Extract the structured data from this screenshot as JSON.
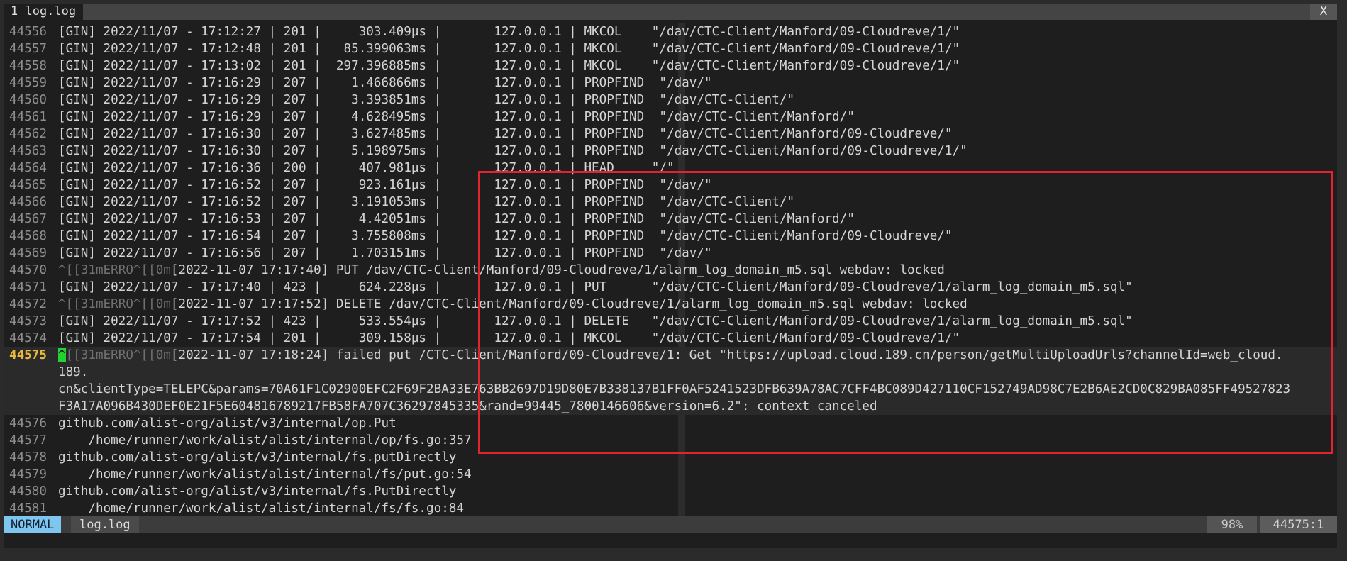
{
  "tabline": {
    "tab_label": "1 log.log",
    "close_label": "X"
  },
  "log": {
    "lines": [
      {
        "n": "44556",
        "text": "[GIN] 2022/11/07 - 17:12:27 | 201 |     303.409µs |       127.0.0.1 | MKCOL    \"/dav/CTC-Client/Manford/09-Cloudreve/1/\""
      },
      {
        "n": "44557",
        "text": "[GIN] 2022/11/07 - 17:12:48 | 201 |   85.399063ms |       127.0.0.1 | MKCOL    \"/dav/CTC-Client/Manford/09-Cloudreve/1/\""
      },
      {
        "n": "44558",
        "text": "[GIN] 2022/11/07 - 17:13:02 | 201 |  297.396885ms |       127.0.0.1 | MKCOL    \"/dav/CTC-Client/Manford/09-Cloudreve/1/\""
      },
      {
        "n": "44559",
        "text": "[GIN] 2022/11/07 - 17:16:29 | 207 |    1.466866ms |       127.0.0.1 | PROPFIND  \"/dav/\""
      },
      {
        "n": "44560",
        "text": "[GIN] 2022/11/07 - 17:16:29 | 207 |    3.393851ms |       127.0.0.1 | PROPFIND  \"/dav/CTC-Client/\""
      },
      {
        "n": "44561",
        "text": "[GIN] 2022/11/07 - 17:16:29 | 207 |    4.628495ms |       127.0.0.1 | PROPFIND  \"/dav/CTC-Client/Manford/\""
      },
      {
        "n": "44562",
        "text": "[GIN] 2022/11/07 - 17:16:30 | 207 |    3.627485ms |       127.0.0.1 | PROPFIND  \"/dav/CTC-Client/Manford/09-Cloudreve/\""
      },
      {
        "n": "44563",
        "text": "[GIN] 2022/11/07 - 17:16:30 | 207 |    5.198975ms |       127.0.0.1 | PROPFIND  \"/dav/CTC-Client/Manford/09-Cloudreve/1/\""
      },
      {
        "n": "44564",
        "text": "[GIN] 2022/11/07 - 17:16:36 | 200 |     407.981µs |       127.0.0.1 | HEAD     \"/\""
      },
      {
        "n": "44565",
        "text": "[GIN] 2022/11/07 - 17:16:52 | 207 |     923.161µs |       127.0.0.1 | PROPFIND  \"/dav/\""
      },
      {
        "n": "44566",
        "text": "[GIN] 2022/11/07 - 17:16:52 | 207 |    3.191053ms |       127.0.0.1 | PROPFIND  \"/dav/CTC-Client/\""
      },
      {
        "n": "44567",
        "text": "[GIN] 2022/11/07 - 17:16:53 | 207 |     4.42051ms |       127.0.0.1 | PROPFIND  \"/dav/CTC-Client/Manford/\""
      },
      {
        "n": "44568",
        "text": "[GIN] 2022/11/07 - 17:16:54 | 207 |    3.755808ms |       127.0.0.1 | PROPFIND  \"/dav/CTC-Client/Manford/09-Cloudreve/\""
      },
      {
        "n": "44569",
        "text": "[GIN] 2022/11/07 - 17:16:56 | 207 |    1.703151ms |       127.0.0.1 | PROPFIND  \"/dav/\""
      }
    ],
    "err_prefix": "^[[31mERRO^[[0m",
    "line_44570": {
      "n": "44570",
      "rest": "[2022-11-07 17:17:40] PUT /dav/CTC-Client/Manford/09-Cloudreve/1/alarm_log_domain_m5.sql webdav: locked"
    },
    "line_44571": {
      "n": "44571",
      "text": "[GIN] 2022/11/07 - 17:17:40 | 423 |     624.228µs |       127.0.0.1 | PUT      \"/dav/CTC-Client/Manford/09-Cloudreve/1/alarm_log_domain_m5.sql\""
    },
    "line_44572": {
      "n": "44572",
      "rest": "[2022-11-07 17:17:52] DELETE /dav/CTC-Client/Manford/09-Cloudreve/1/alarm_log_domain_m5.sql webdav: locked"
    },
    "line_44573": {
      "n": "44573",
      "text": "[GIN] 2022/11/07 - 17:17:52 | 423 |     533.554µs |       127.0.0.1 | DELETE   \"/dav/CTC-Client/Manford/09-Cloudreve/1/alarm_log_domain_m5.sql\""
    },
    "line_44574": {
      "n": "44574",
      "text": "[GIN] 2022/11/07 - 17:17:54 | 201 |     309.158µs |       127.0.0.1 | MKCOL    \"/dav/CTC-Client/Manford/09-Cloudreve/1/\""
    },
    "line_44575": {
      "n": "44575",
      "caret": "^",
      "seg1_rest": "[[31mERRO",
      "seg2_caret": "^",
      "seg2_rest": "[[0m",
      "rest": "[2022-11-07 17:18:24] failed put /CTC-Client/Manford/09-Cloudreve/1: Get \"https://upload.cloud.189.cn/person/getMultiUploadUrls?channelId=web_cloud.",
      "wrap1": "189.",
      "wrap2": "cn&clientType=TELEPC&params=70A61F1C02900EFC2F69F2BA33E763BB2697D19D80E7B338137B1FF0AF5241523DFB639A78AC7CFF4BC089D427110CF152749AD98C7E2B6AE2CD0C829BA085FF49527823",
      "wrap3": "F3A17A096B430DEF0E21F5E604816789217FB58FA707C36297845335&rand=99445_7800146606&version=6.2\": context canceled"
    },
    "tail": [
      {
        "n": "44576",
        "text": "github.com/alist-org/alist/v3/internal/op.Put"
      },
      {
        "n": "44577",
        "text": "    /home/runner/work/alist/alist/internal/op/fs.go:357"
      },
      {
        "n": "44578",
        "text": "github.com/alist-org/alist/v3/internal/fs.putDirectly"
      },
      {
        "n": "44579",
        "text": "    /home/runner/work/alist/alist/internal/fs/put.go:54"
      },
      {
        "n": "44580",
        "text": "github.com/alist-org/alist/v3/internal/fs.PutDirectly"
      },
      {
        "n": "44581",
        "text": "    /home/runner/work/alist/alist/internal/fs/fs.go:84"
      }
    ]
  },
  "statusline": {
    "mode": "NORMAL",
    "filename": "log.log",
    "percent": "98%",
    "position": "44575:1"
  },
  "colors": {
    "highlight_box": "#e3242f",
    "mode_bg": "#7ec6f0",
    "cursor_line_number": "#e8b83c",
    "cursor_block": "#22d132"
  }
}
